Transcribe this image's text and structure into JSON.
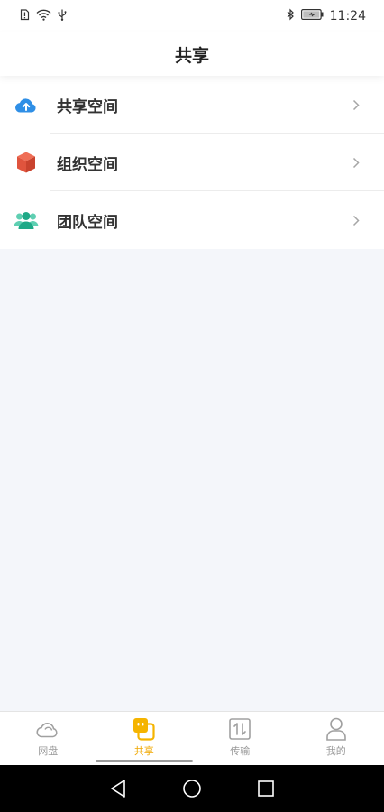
{
  "status_bar": {
    "time": "11:24",
    "icons": [
      "sim-icon",
      "wifi-icon",
      "usb-icon",
      "bluetooth-icon",
      "battery-icon"
    ]
  },
  "header": {
    "title": "共享"
  },
  "menu": {
    "items": [
      {
        "label": "共享空间",
        "icon": "cloud-upload-icon",
        "color": "#2f8fe6"
      },
      {
        "label": "组织空间",
        "icon": "cube-icon",
        "color": "#e85c42"
      },
      {
        "label": "团队空间",
        "icon": "team-icon",
        "color": "#22b58f"
      }
    ]
  },
  "tab_bar": {
    "tabs": [
      {
        "label": "网盘",
        "icon": "cloud-icon",
        "active": false
      },
      {
        "label": "共享",
        "icon": "share-icon",
        "active": true
      },
      {
        "label": "传输",
        "icon": "transfer-icon",
        "active": false
      },
      {
        "label": "我的",
        "icon": "profile-icon",
        "active": false
      }
    ],
    "active_color": "#f0a800",
    "inactive_color": "#9a9a9a"
  },
  "system_nav": {
    "buttons": [
      "back-icon",
      "home-icon",
      "recents-icon"
    ]
  }
}
